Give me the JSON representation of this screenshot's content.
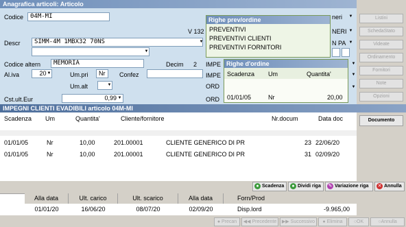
{
  "window": {
    "title": "Anagrafica articoli: Articolo"
  },
  "form": {
    "codice_label": "Codice",
    "codice_value": "04M-MI",
    "v_label": "V 132",
    "descr_label": "Descr",
    "descr_value": "SIMM-4M 1MBX32 70NS",
    "codice_altern_label": "Codice altern",
    "codice_altern_value": "MEMORIA",
    "decim_label": "Decim",
    "decim_value": "2",
    "aliva_label": "Al.iva",
    "aliva_value": "20",
    "umpri_label": "Um.pri",
    "umpri_value": "Nr",
    "confez_label": "Confez",
    "umalt_label": "Um.alt",
    "cstult_label": "Cst.ult.Eur",
    "cstult_value": "0,99",
    "right_frag1": "neri",
    "right_frag2": "NERI",
    "right_frag3": "N  PA",
    "impe1": "IMPE",
    "impe2": "IMPE",
    "ord1": "ORD",
    "ord2": "ORD"
  },
  "popup_righe_prev": {
    "title": "Righe prev/ordine",
    "items": [
      "PREVENTIVI",
      "PREVENTIVI CLIENTI",
      "PREVENTIVI FORNITORI"
    ]
  },
  "popup_righe_ordine": {
    "title": "Righe d'ordine",
    "headers": [
      "Scadenza",
      "Um",
      "Quantita'"
    ],
    "row": [
      "01/01/05",
      "Nr",
      "20,00"
    ]
  },
  "right_buttons": [
    "Listini",
    "SchedaStato",
    "Videate",
    "Ordinamento",
    "Fornitori",
    "Note",
    "Opzioni"
  ],
  "impegni": {
    "title": "IMPEGNI CLIENTI EVADIBILI articolo 04M-MI",
    "headers": [
      "Scadenza",
      "Um",
      "Quantita'",
      "Cliente/fornitore",
      "Nr.docum",
      "Data doc"
    ],
    "rows": [
      [
        "01/01/05",
        "Nr",
        "10,00",
        "201.00001",
        "CLIENTE GENERICO DI PR",
        "23",
        "22/06/20"
      ],
      [
        "01/01/05",
        "Nr",
        "10,00",
        "201.00001",
        "CLIENTE GENERICO DI PR",
        "31",
        "02/09/20"
      ]
    ],
    "documento_button": "Documento"
  },
  "actions": {
    "scadenza": "Scadenza",
    "dividi_riga": "Dividi riga",
    "variazione_riga": "Variazione riga",
    "annulla": "Annulla"
  },
  "summary": {
    "headers": [
      "Alla data",
      "Ult. carico",
      "Ult. scarico",
      "Alla data",
      "Forn/Prod"
    ],
    "values": [
      "01/01/20",
      "16/06/20",
      "08/07/20",
      "02/09/20",
      "Disp.lord"
    ],
    "disp_value": "-9.965,00"
  },
  "nav": [
    "Precan",
    "Precedente",
    "Successivo",
    "Elimina",
    "OK",
    "Annulla"
  ],
  "colors": {
    "title_start": "#6f8fba",
    "title_end": "#9eb4d2",
    "form_bg": "#cfe0ee",
    "popup_bg": "#eef5e6"
  }
}
